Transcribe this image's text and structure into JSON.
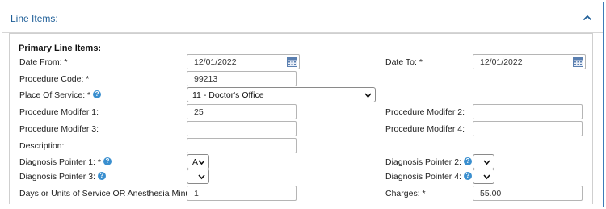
{
  "panel": {
    "title": "Line Items:"
  },
  "section": {
    "title": "Primary Line Items:"
  },
  "fields": {
    "date_from": {
      "label": "Date From: *",
      "value": "12/01/2022"
    },
    "date_to": {
      "label": "Date To: *",
      "value": "12/01/2022"
    },
    "procedure_code": {
      "label": "Procedure Code: *",
      "value": "99213"
    },
    "place_of_service": {
      "label": "Place Of Service: *",
      "value": "11 - Doctor's Office"
    },
    "modifier_1": {
      "label": "Procedure Modifer 1:",
      "value": "25"
    },
    "modifier_2": {
      "label": "Procedure Modifer 2:",
      "value": ""
    },
    "modifier_3": {
      "label": "Procedure Modifer 3:",
      "value": ""
    },
    "modifier_4": {
      "label": "Procedure Modifer 4:",
      "value": ""
    },
    "description": {
      "label": "Description:",
      "value": ""
    },
    "diag_pointer_1": {
      "label": "Diagnosis Pointer 1: *",
      "value": "A"
    },
    "diag_pointer_2": {
      "label": "Diagnosis Pointer 2:",
      "value": ""
    },
    "diag_pointer_3": {
      "label": "Diagnosis Pointer 3:",
      "value": ""
    },
    "diag_pointer_4": {
      "label": "Diagnosis Pointer 4:",
      "value": ""
    },
    "days_units": {
      "label": "Days or Units of Service OR Anesthesia Minutes *",
      "value": "1"
    },
    "charges": {
      "label": "Charges: *",
      "value": "55.00"
    }
  },
  "icons": {
    "help": "help-icon",
    "calendar": "calendar-icon",
    "collapse": "chevron-up-icon"
  },
  "colors": {
    "accent": "#1f5f98",
    "border": "#3c7bb8",
    "help": "#3a8fcf"
  }
}
